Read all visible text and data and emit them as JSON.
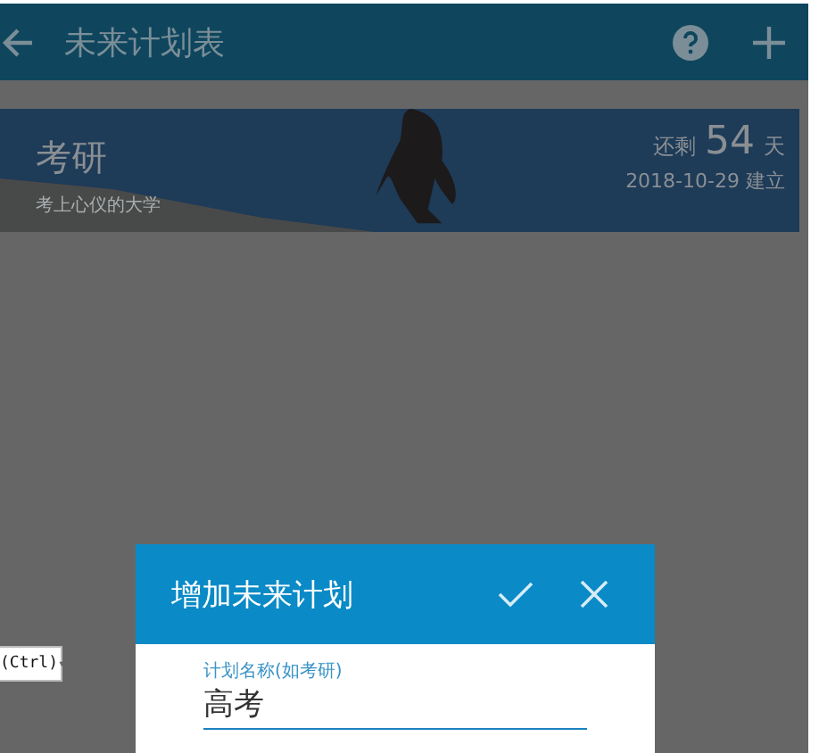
{
  "app_bar": {
    "title": "未来计划表"
  },
  "plan_card": {
    "name": "考研",
    "description": "考上心仪的大学",
    "remaining_label": "还剩",
    "remaining_days": "54",
    "days_unit": "天",
    "created": "2018-10-29 建立"
  },
  "paste_popup": {
    "label": "(Ctrl)",
    "caret": "▾"
  },
  "dialog": {
    "title": "增加未来计划",
    "name_field": {
      "label": "计划名称(如考研)",
      "value": "高考"
    }
  }
}
